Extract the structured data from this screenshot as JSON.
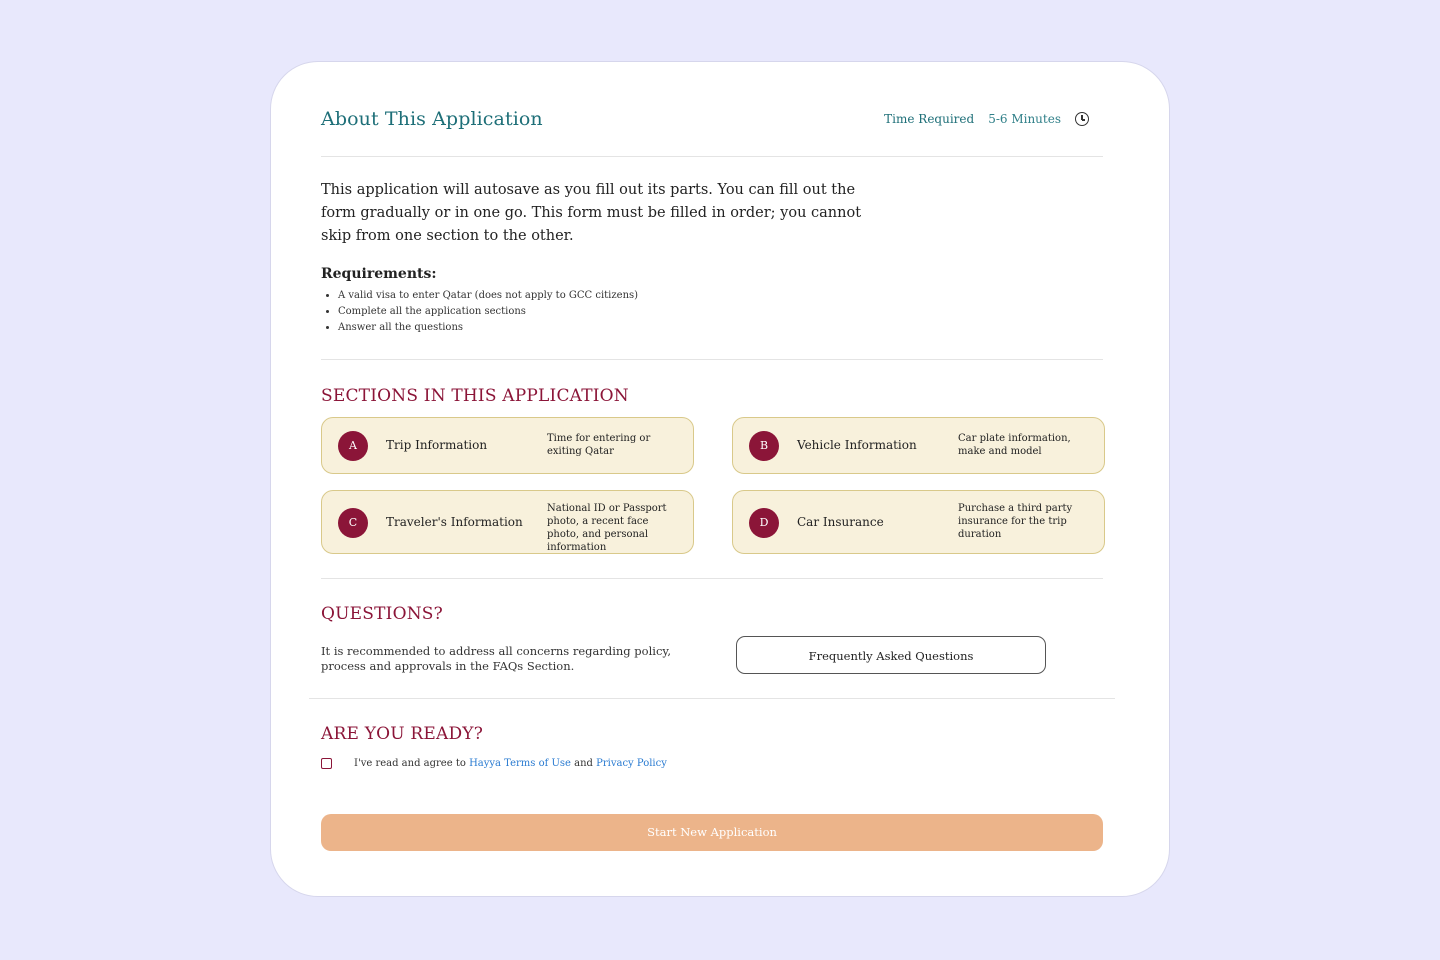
{
  "header": {
    "title": "About This Application",
    "time_label": "Time Required",
    "time_value": "5-6 Minutes",
    "time_icon": "clock-icon"
  },
  "intro": "This application will autosave as you fill out its parts. You can fill out the form gradually or in one go. This form must be filled in order; you cannot skip from one section to the other.",
  "requirements": {
    "title": "Requirements:",
    "items": [
      "A valid visa to enter Qatar (does not apply to GCC citizens)",
      "Complete all the application sections",
      "Answer all the questions"
    ]
  },
  "sections": {
    "heading": "SECTIONS IN THIS APPLICATION",
    "items": [
      {
        "badge": "A",
        "title": "Trip Information",
        "desc": "Time for entering or exiting Qatar"
      },
      {
        "badge": "B",
        "title": "Vehicle Information",
        "desc": "Car plate information, make and model"
      },
      {
        "badge": "C",
        "title": "Traveler's Information",
        "desc": "National ID or Passport photo, a recent face photo, and personal information"
      },
      {
        "badge": "D",
        "title": "Car Insurance",
        "desc": "Purchase a third party insurance for the trip duration"
      }
    ]
  },
  "questions": {
    "heading": "QUESTIONS?",
    "text": "It is recommended to address all concerns regarding policy, process and approvals in the FAQs Section.",
    "faq_button": "Frequently Asked Questions"
  },
  "ready": {
    "heading": "ARE YOU READY?",
    "agree_prefix": "I've read and agree to",
    "terms_link": "Hayya Terms of Use",
    "and_word": "and",
    "privacy_link": "Privacy Policy",
    "start_button": "Start New Application"
  },
  "colors": {
    "page_bg": "#e8e8fc",
    "heading_teal": "#1e6f78",
    "accent_maroon": "#8b1538",
    "section_bg": "#f8f1dc",
    "start_button_bg": "#ecb48a",
    "link": "#2a7bd1"
  }
}
